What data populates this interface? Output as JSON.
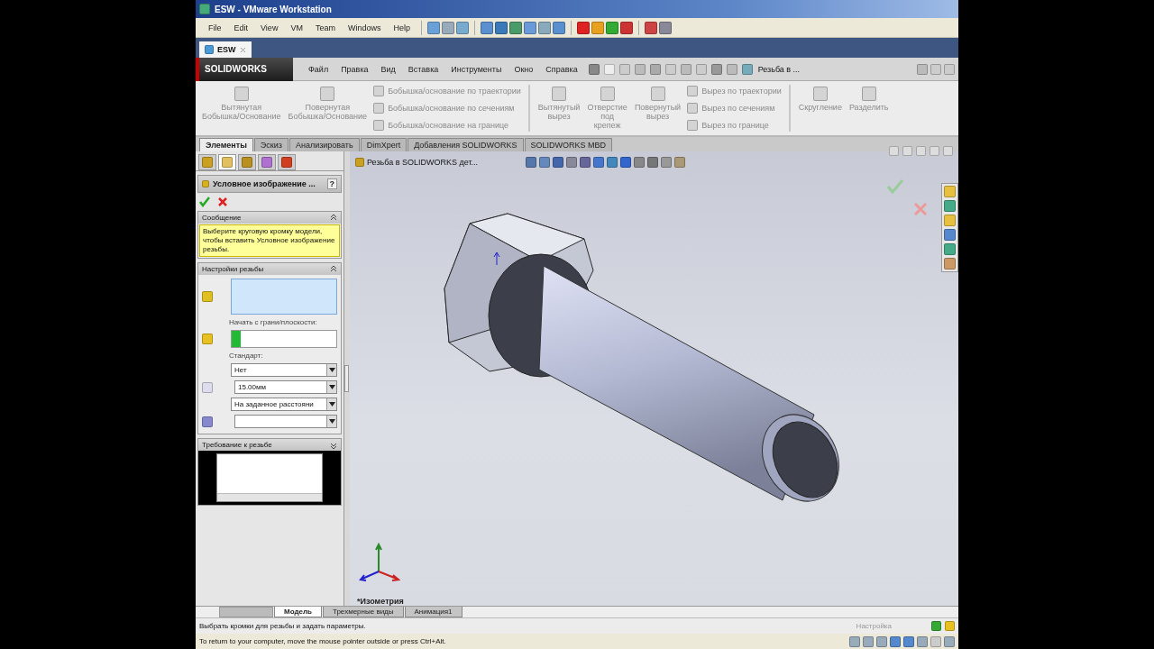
{
  "vm_window": {
    "title": "ESW - VMware Workstation",
    "menu": [
      "File",
      "Edit",
      "View",
      "VM",
      "Team",
      "Windows",
      "Help"
    ],
    "tab": {
      "label": "ESW"
    },
    "status": "To return to your computer, move the mouse pointer outside or press Ctrl+Alt."
  },
  "app": {
    "logo": "SOLIDWORKS",
    "menu": [
      "Файл",
      "Правка",
      "Вид",
      "Вставка",
      "Инструменты",
      "Окно",
      "Справка"
    ],
    "document_title": "Резьба в ..."
  },
  "ribbon": [
    {
      "kind": "large",
      "lines": [
        "Вытянутая",
        "Бобышка/Основание"
      ],
      "disabled": true
    },
    {
      "kind": "large",
      "lines": [
        "Повернутая",
        "Бобышка/Основание"
      ],
      "disabled": true
    },
    {
      "kind": "stack",
      "items": [
        {
          "label": "Бобышка/основание по траектории",
          "disabled": true
        },
        {
          "label": "Бобышка/основание по сечениям",
          "disabled": true
        },
        {
          "label": "Бобышка/основание на границе",
          "disabled": true
        }
      ]
    },
    {
      "kind": "separator"
    },
    {
      "kind": "large",
      "lines": [
        "Вытянутый",
        "вырез"
      ],
      "disabled": true
    },
    {
      "kind": "large",
      "lines": [
        "Отверстие",
        "под",
        "крепеж"
      ],
      "disabled": true
    },
    {
      "kind": "large",
      "lines": [
        "Повернутый",
        "вырез"
      ],
      "disabled": true
    },
    {
      "kind": "stack",
      "items": [
        {
          "label": "Вырез по траектории",
          "disabled": true
        },
        {
          "label": "Вырез по сечениям",
          "disabled": true
        },
        {
          "label": "Вырез по границе",
          "disabled": true
        }
      ]
    },
    {
      "kind": "separator"
    },
    {
      "kind": "large",
      "lines": [
        "Скругление"
      ],
      "disabled": true
    },
    {
      "kind": "large",
      "lines": [
        "Разделить"
      ],
      "disabled": true
    }
  ],
  "tabs": [
    {
      "label": "Элементы",
      "selected": true
    },
    {
      "label": "Эскиз",
      "selected": false
    },
    {
      "label": "Анализировать",
      "selected": false
    },
    {
      "label": "DimXpert",
      "selected": false
    },
    {
      "label": "Добавления SOLIDWORKS",
      "selected": false
    },
    {
      "label": "SOLIDWORKS MBD",
      "selected": false
    }
  ],
  "panel_tabs": [
    {
      "selected": false
    },
    {
      "selected": true
    },
    {
      "selected": false
    },
    {
      "selected": false
    },
    {
      "selected": false
    }
  ],
  "property_manager": {
    "title": "Условное изображение ...",
    "help": "?",
    "message": {
      "title": "Сообщение",
      "text": "Выберите круговую кромку модели, чтобы вставить Условное изображение резьбы."
    },
    "settings": {
      "title": "Настройки резьбы",
      "start_label": "Начать с грани/плоскости:",
      "standard_label": "Стандарт:",
      "standard": "Нет",
      "diameter": "15.00мм",
      "end_condition": "На заданное расстояни"
    },
    "requirement": {
      "title": "Требование к резьбе"
    }
  },
  "viewport": {
    "breadcrumb": "Резьба в SOLIDWORKS дет...",
    "view_label": "*Изометрия"
  },
  "bottom_tabs": [
    {
      "label": "Модель",
      "selected": true
    },
    {
      "label": "Трехмерные виды",
      "selected": false
    },
    {
      "label": "Анимация1",
      "selected": false
    }
  ],
  "status_bar": {
    "hint": "Выбрать кромки для резьбы и задать параметры.",
    "config": "Настройка"
  }
}
